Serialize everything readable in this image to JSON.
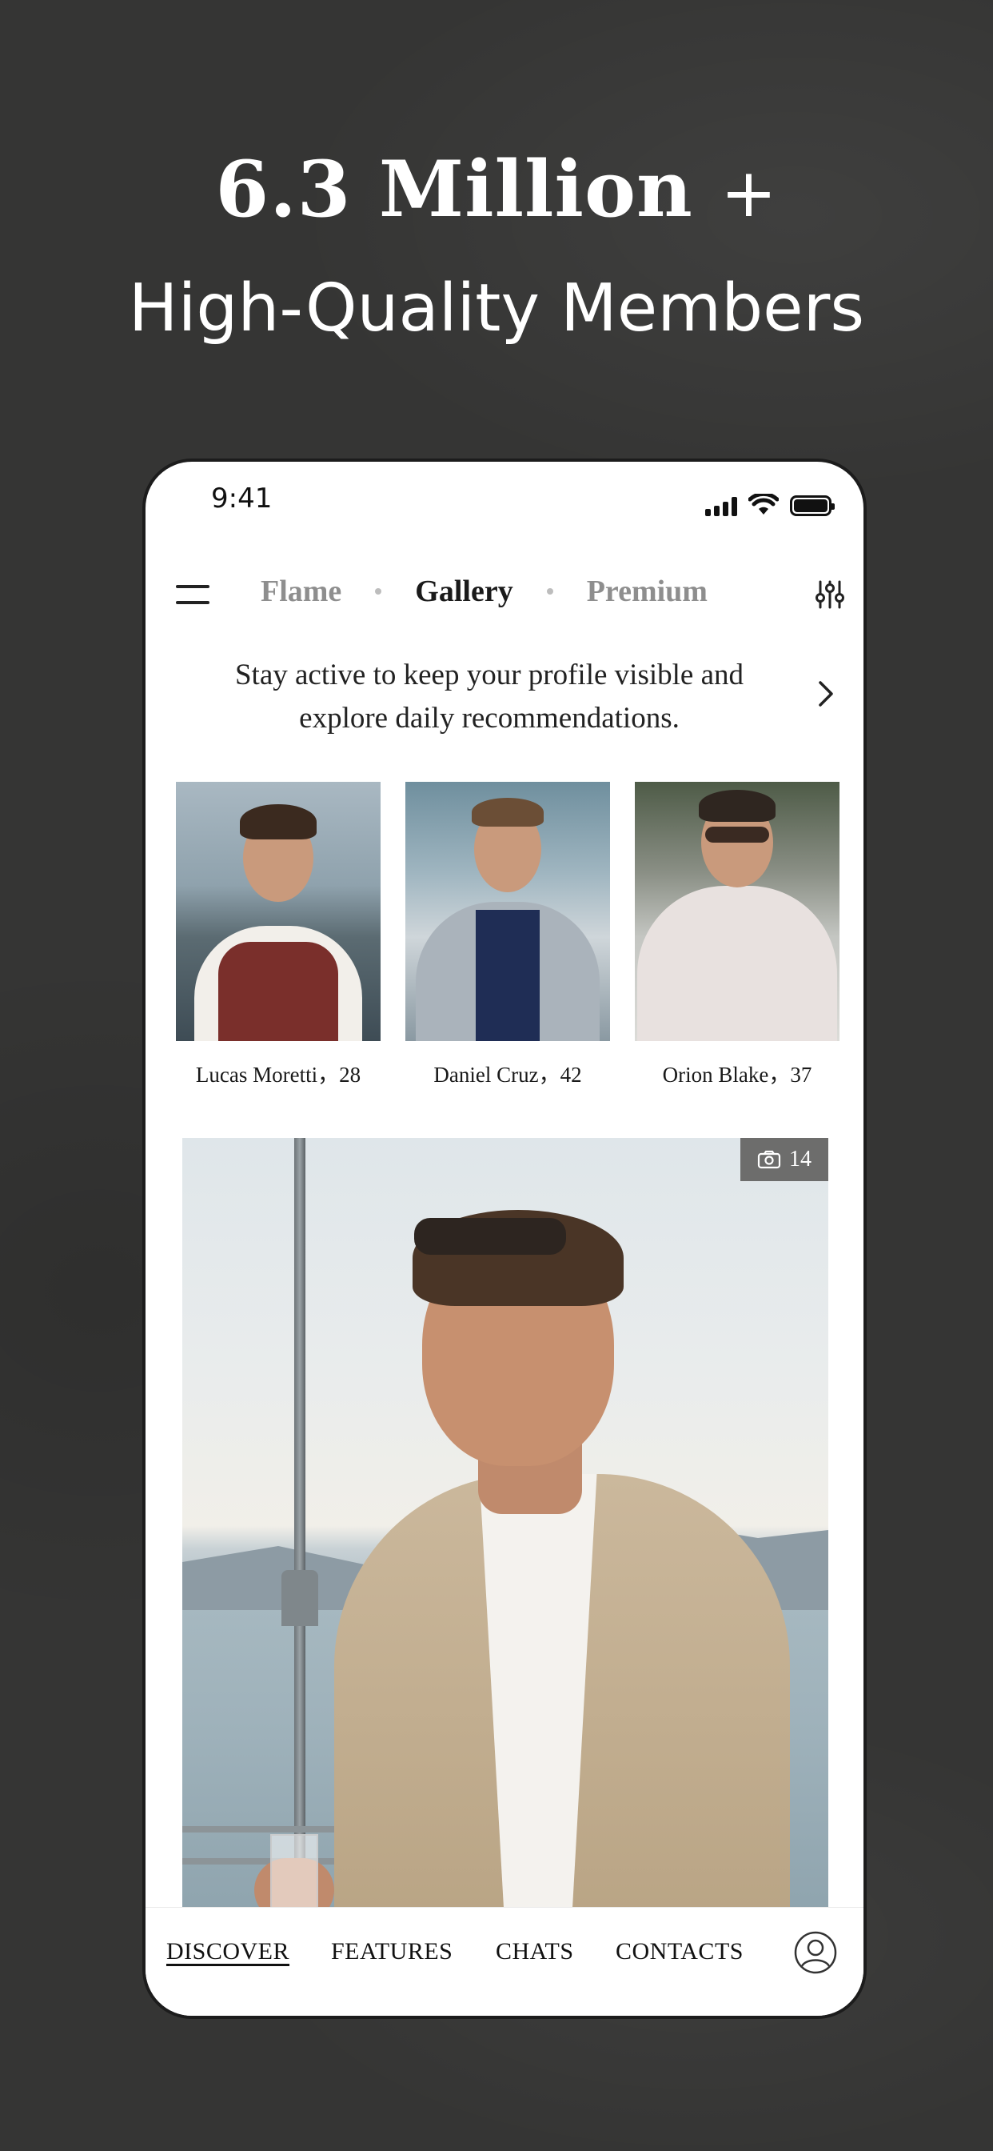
{
  "hero": {
    "count": "6.3 Million",
    "plus": "+",
    "subtitle": "High-Quality Members"
  },
  "status_bar": {
    "time": "9:41"
  },
  "top_nav": {
    "tabs": [
      {
        "label": "Flame",
        "active": false
      },
      {
        "label": "Gallery",
        "active": true
      },
      {
        "label": "Premium",
        "active": false
      }
    ]
  },
  "notice": {
    "text": "Stay active to keep your profile visible and explore daily recommendations."
  },
  "recommendations": [
    {
      "name": "Lucas Moretti，28"
    },
    {
      "name": "Daniel Cruz，42"
    },
    {
      "name": "Orion Blake，37"
    }
  ],
  "featured": {
    "photo_count": "14"
  },
  "bottom_nav": {
    "items": [
      {
        "label": "DISCOVER",
        "active": true
      },
      {
        "label": "FEATURES",
        "active": false
      },
      {
        "label": "CHATS",
        "active": false
      },
      {
        "label": "CONTACTS",
        "active": false
      }
    ]
  },
  "colors": {
    "background": "#353534",
    "card": "#ffffff",
    "active_tab": "#1a1a1a",
    "inactive_tab": "#8e8e8e",
    "badge": "#6d6d6c"
  }
}
